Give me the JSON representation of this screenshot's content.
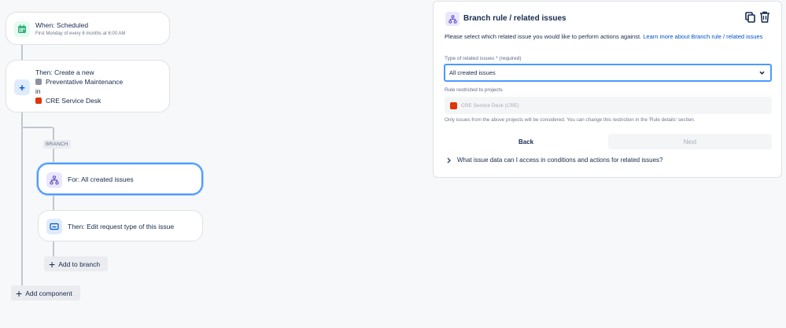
{
  "trigger": {
    "title": "When: Scheduled",
    "subtitle": "First Monday of every 6 months at 6:00 AM"
  },
  "action_create": {
    "title": "Then: Create a new",
    "issue_type": "Preventative Maintenance",
    "connector": "in",
    "project": "CRE Service Desk"
  },
  "branch_tag": "BRANCH",
  "branch_for": {
    "title": "For: All created issues"
  },
  "branch_action": {
    "title": "Then: Edit request type of this issue"
  },
  "add_to_branch": "Add to branch",
  "add_component": "Add component",
  "panel": {
    "title": "Branch rule / related issues",
    "description": "Please select which related issue you would like to perform actions against.",
    "learn_more": "Learn more about Branch rule / related issues",
    "type_label": "Type of related issues *",
    "type_required": "(required)",
    "type_value": "All created issues",
    "restricted_label": "Rule restricted to projects",
    "restricted_project": "CRE Service Desk (CRE)",
    "help_text": "Only issues from the above projects will be considered. You can change this restriction in the 'Rule details' section.",
    "back_label": "Back",
    "next_label": "Next",
    "expander_text": "What issue data can I access in conditions and actions for related issues?"
  },
  "colors": {
    "accent_blue": "#4c9aff",
    "link_blue": "#0052cc",
    "trigger_green": "#36b37e",
    "branch_purple": "#6554c0",
    "project_red": "#de350b"
  }
}
